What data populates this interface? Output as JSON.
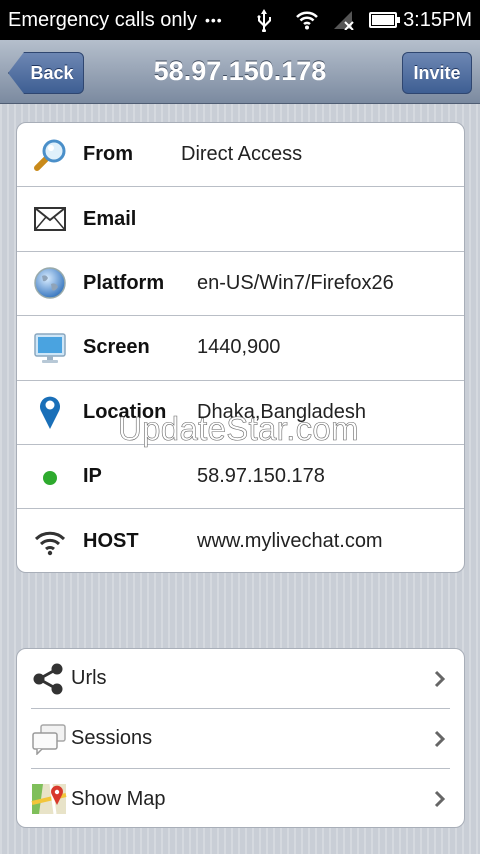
{
  "status_bar": {
    "carrier": "Emergency calls only",
    "dots": "•••",
    "time": "3:15PM",
    "battery_level": 1.0
  },
  "navbar": {
    "title": "58.97.150.178",
    "back_label": "Back",
    "invite_label": "Invite"
  },
  "info": {
    "rows": [
      {
        "icon": "search-icon",
        "label": "From",
        "value": "Direct Access"
      },
      {
        "icon": "envelope-icon",
        "label": "Email",
        "value": ""
      },
      {
        "icon": "globe-icon",
        "label": "Platform",
        "value": "en-US/Win7/Firefox26"
      },
      {
        "icon": "monitor-icon",
        "label": "Screen",
        "value": "1440,900"
      },
      {
        "icon": "map-pin-icon",
        "label": "Location",
        "value": "Dhaka,Bangladesh"
      },
      {
        "icon": "online-dot-icon",
        "label": "IP",
        "value": "58.97.150.178"
      },
      {
        "icon": "wifi-icon",
        "label": "HOST",
        "value": "www.mylivechat.com"
      }
    ]
  },
  "links": [
    {
      "icon": "share-icon",
      "label": "Urls"
    },
    {
      "icon": "chat-bubbles-icon",
      "label": "Sessions"
    },
    {
      "icon": "map-icon",
      "label": "Show Map"
    }
  ],
  "watermark": "UpdateStar.com",
  "colors": {
    "nav_button": "#4a6a9f",
    "online_dot": "#2eaa2e",
    "pin": "#1a6fb8"
  }
}
